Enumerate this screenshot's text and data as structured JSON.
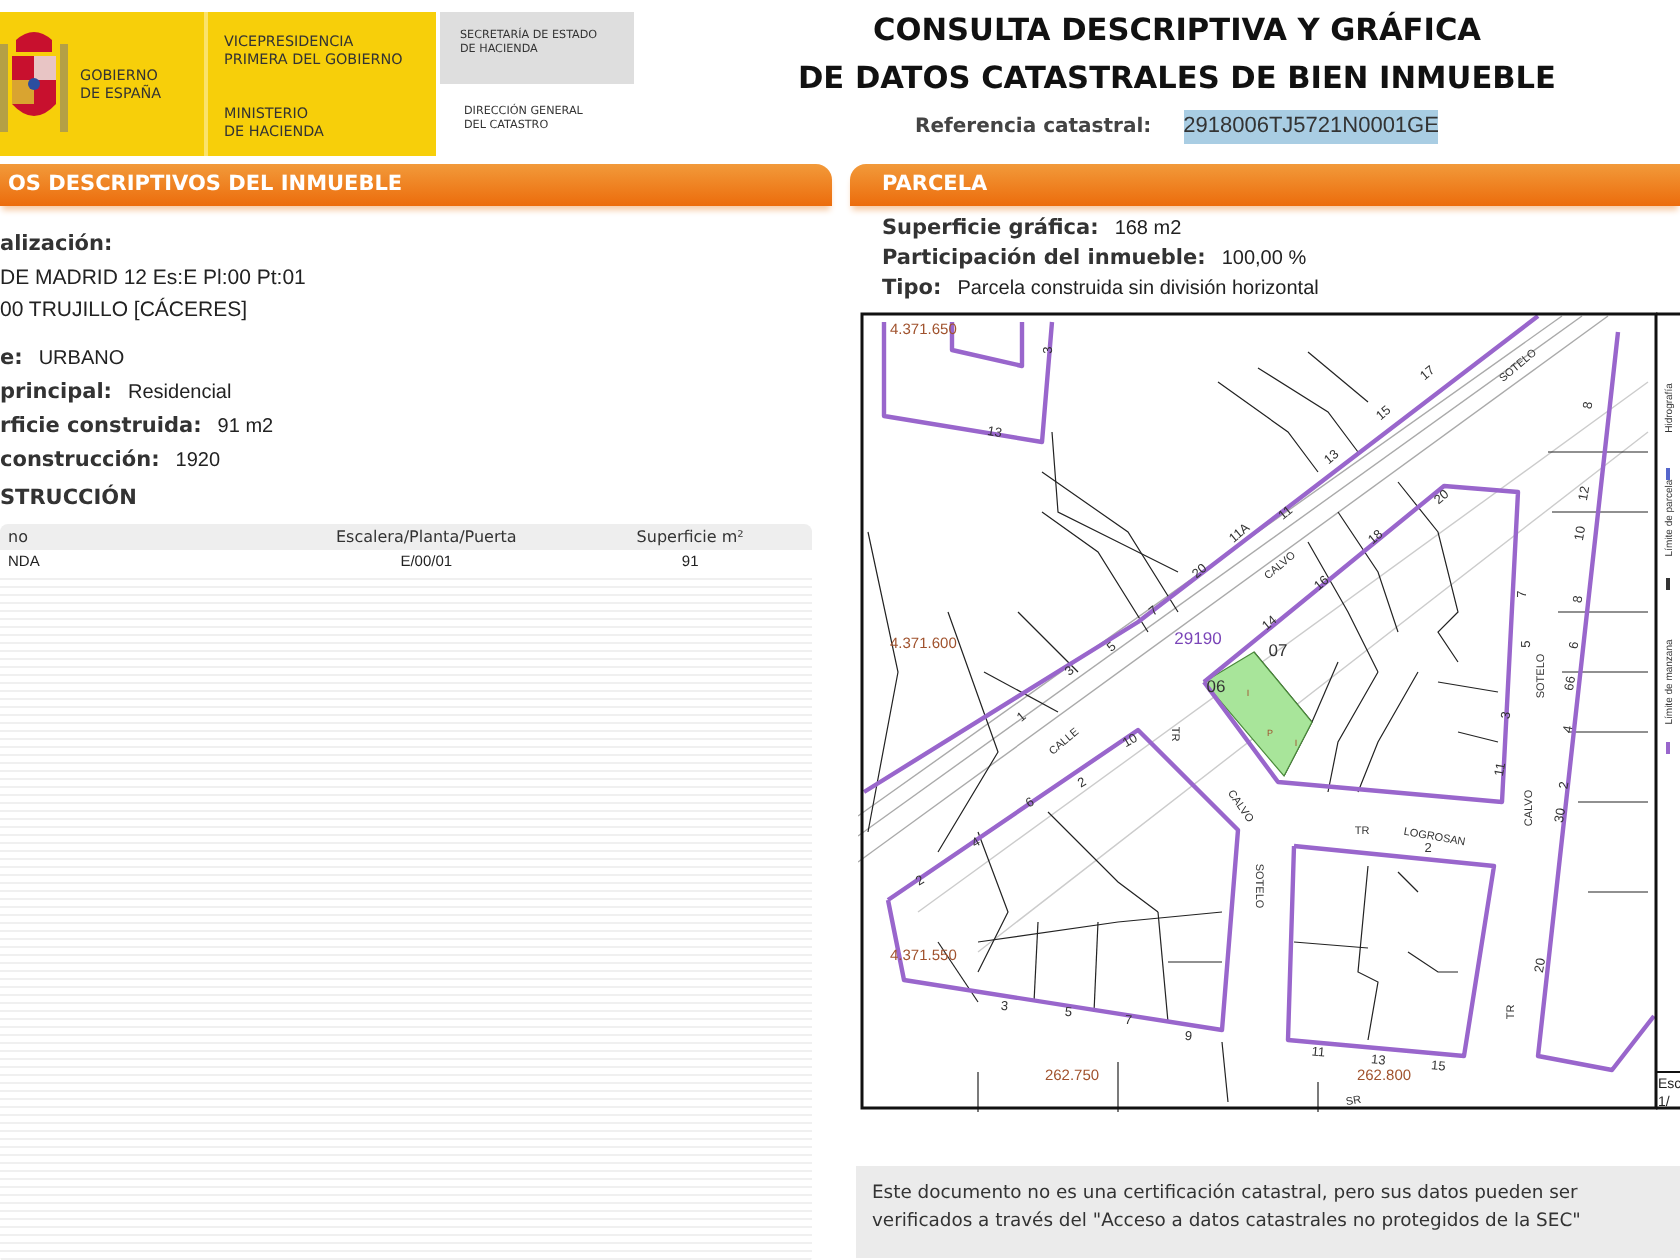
{
  "logo": {
    "country": [
      "GOBIERNO",
      "DE ESPAÑA"
    ],
    "vicepresidency": [
      "VICEPRESIDENCIA",
      "PRIMERA DEL GOBIERNO"
    ],
    "ministry": [
      "MINISTERIO",
      "DE HACIENDA"
    ],
    "secretariat": [
      "SECRETARÍA DE ESTADO",
      "DE HACIENDA"
    ],
    "directorate": [
      "DIRECCIÓN GENERAL",
      "DEL CATASTRO"
    ]
  },
  "document_title": [
    "CONSULTA DESCRIPTIVA Y GRÁFICA",
    "DE DATOS CATASTRALES DE BIEN INMUEBLE"
  ],
  "reference": {
    "label": "Referencia catastral:",
    "value": "2918006TJ5721N0001GE",
    "highlighted": true
  },
  "descriptive_panel": {
    "title": "OS DESCRIPTIVOS DEL INMUEBLE",
    "location_label": "alización:",
    "location_lines": [
      "DE MADRID 12 Es:E Pl:00 Pt:01",
      "00 TRUJILLO [CÁCERES]"
    ],
    "fields": [
      {
        "label": "e:",
        "value": "URBANO"
      },
      {
        "label": "principal:",
        "value": "Residencial"
      },
      {
        "label": "rficie construida:",
        "value": "91 m2"
      },
      {
        "label": "construcción:",
        "value": "1920"
      }
    ],
    "section_title": "STRUCCIÓN",
    "table": {
      "columns": [
        "no",
        "Escalera/Planta/Puerta",
        "Superficie m²"
      ],
      "rows": [
        [
          "NDA",
          "E/00/01",
          "91"
        ]
      ]
    }
  },
  "parcel_panel": {
    "title": "PARCELA",
    "fields": [
      {
        "label": "Superficie gráfica:",
        "value": "168 m2"
      },
      {
        "label": "Participación del inmueble:",
        "value": "100,00 %"
      },
      {
        "label": "Tipo:",
        "value": "Parcela construida sin división horizontal"
      }
    ],
    "map": {
      "labels": [
        {
          "text": "4.371.650",
          "kind": "coordinate"
        },
        {
          "text": "4.371.600",
          "kind": "coordinate"
        },
        {
          "text": "4.371.550",
          "kind": "coordinate"
        },
        {
          "text": "262.750",
          "kind": "coordinate"
        },
        {
          "text": "262.800",
          "kind": "coordinate"
        },
        {
          "text": "29190",
          "kind": "parcel"
        },
        {
          "text": "06",
          "kind": "parcel_number"
        },
        {
          "text": "07",
          "kind": "parcel_number"
        },
        {
          "text": "CALVO",
          "kind": "street"
        },
        {
          "text": "SOTELO",
          "kind": "street"
        },
        {
          "text": "CALLE",
          "kind": "street"
        },
        {
          "text": "TR",
          "kind": "street"
        },
        {
          "text": "CALVO",
          "kind": "street"
        },
        {
          "text": "SOTELO",
          "kind": "street"
        },
        {
          "text": "TR",
          "kind": "street"
        },
        {
          "text": "LOGROSAN",
          "kind": "street"
        },
        {
          "text": "SOTELO",
          "kind": "street"
        },
        {
          "text": "CALVO",
          "kind": "street"
        },
        {
          "text": "TR",
          "kind": "street"
        },
        {
          "text": "SR",
          "kind": "street"
        },
        {
          "text": "1",
          "kind": "number"
        },
        {
          "text": "3",
          "kind": "number"
        },
        {
          "text": "5",
          "kind": "number"
        },
        {
          "text": "7",
          "kind": "number"
        },
        {
          "text": "20",
          "kind": "number"
        },
        {
          "text": "11A",
          "kind": "number"
        },
        {
          "text": "11",
          "kind": "number"
        },
        {
          "text": "13",
          "kind": "number"
        },
        {
          "text": "15",
          "kind": "number"
        },
        {
          "text": "17",
          "kind": "number"
        },
        {
          "text": "14",
          "kind": "number"
        },
        {
          "text": "16",
          "kind": "number"
        },
        {
          "text": "18",
          "kind": "number"
        },
        {
          "text": "20",
          "kind": "number"
        },
        {
          "text": "7",
          "kind": "number"
        },
        {
          "text": "5",
          "kind": "number"
        },
        {
          "text": "3",
          "kind": "number"
        },
        {
          "text": "11",
          "kind": "number"
        },
        {
          "text": "8",
          "kind": "number"
        },
        {
          "text": "12",
          "kind": "number"
        },
        {
          "text": "10",
          "kind": "number"
        },
        {
          "text": "8",
          "kind": "number"
        },
        {
          "text": "6",
          "kind": "number"
        },
        {
          "text": "66",
          "kind": "number"
        },
        {
          "text": "4",
          "kind": "number"
        },
        {
          "text": "2",
          "kind": "number"
        },
        {
          "text": "30",
          "kind": "number"
        },
        {
          "text": "20",
          "kind": "number"
        },
        {
          "text": "13",
          "kind": "number"
        },
        {
          "text": "3",
          "kind": "number"
        },
        {
          "text": "2",
          "kind": "number"
        },
        {
          "text": "4",
          "kind": "number"
        },
        {
          "text": "6",
          "kind": "number"
        },
        {
          "text": "2",
          "kind": "number"
        },
        {
          "text": "10",
          "kind": "number"
        },
        {
          "text": "3",
          "kind": "number"
        },
        {
          "text": "5",
          "kind": "number"
        },
        {
          "text": "7",
          "kind": "number"
        },
        {
          "text": "9",
          "kind": "number"
        },
        {
          "text": "2",
          "kind": "number"
        },
        {
          "text": "11",
          "kind": "number"
        },
        {
          "text": "13",
          "kind": "number"
        },
        {
          "text": "15",
          "kind": "number"
        },
        {
          "text": "I",
          "kind": "unit"
        },
        {
          "text": "P",
          "kind": "unit"
        },
        {
          "text": "I",
          "kind": "unit"
        }
      ],
      "legend": [
        "Límite de manzana",
        "Límite de parcela",
        "Hidrografía"
      ],
      "scale": [
        "Esc",
        "1/"
      ]
    }
  },
  "note": "Este documento no es una certificación catastral, pero sus datos pueden ser verificados a través del \"Acceso a datos catastrales no protegidos de la SEC\""
}
